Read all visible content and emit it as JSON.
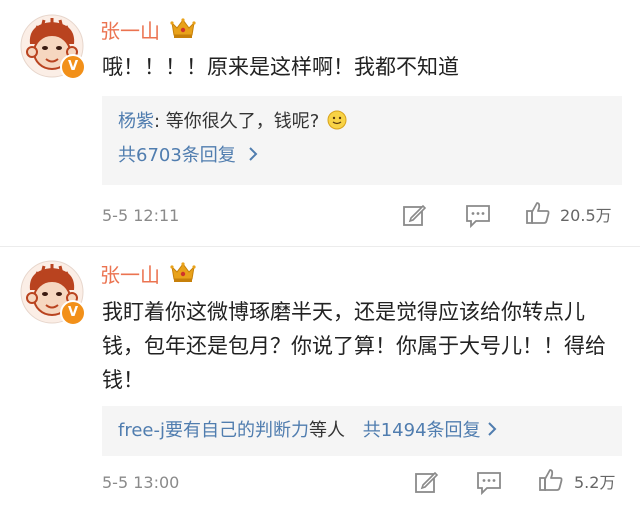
{
  "comments": [
    {
      "username": "张一山",
      "badge": "V",
      "text": "哦！！！！原来是这样啊！我都不知道",
      "reply_author": "杨紫",
      "reply_text": ": 等你很久了，钱呢?",
      "reply_count": "共6703条回复",
      "time": "5-5 12:11",
      "likes": "20.5万"
    },
    {
      "username": "张一山",
      "badge": "V",
      "text": "我盯着你这微博琢磨半天，还是觉得应该给你转点儿钱，包年还是包月？你说了算！你属于大号儿！！得给钱！",
      "reply_author": "free-j要有自己的判断力",
      "reply_text": "等人",
      "reply_count": "共1494条回复",
      "time": "5-5 13:00",
      "likes": "5.2万"
    }
  ],
  "colors": {
    "username": "#eb7350",
    "link": "#507daf",
    "reply_bg": "#f5f5f5",
    "badge": "#f29019",
    "crown": "#e9a21a"
  },
  "icons": {
    "crown": "crown-icon",
    "smile": "smile-emoji-icon",
    "edit": "edit-icon",
    "comment": "comment-icon",
    "like": "thumbs-up-icon",
    "chevron": "chevron-right-icon"
  }
}
